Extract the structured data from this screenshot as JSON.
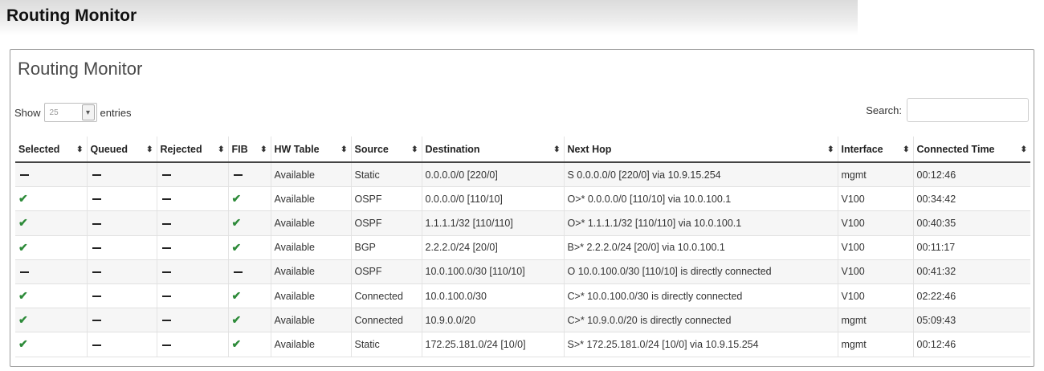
{
  "page": {
    "title": "Routing Monitor"
  },
  "panel": {
    "title": "Routing Monitor",
    "show_label": "Show",
    "entries_value": "25",
    "entries_label": "entries",
    "search_label": "Search:",
    "search_value": ""
  },
  "colors": {
    "check": "#2e8b3a",
    "header_rule": "#444444",
    "row_stripe": "#f6f6f6"
  },
  "table": {
    "columns": [
      "Selected",
      "Queued",
      "Rejected",
      "FIB",
      "HW Table",
      "Source",
      "Destination",
      "Next Hop",
      "Interface",
      "Connected Time"
    ],
    "rows": [
      {
        "selected": "dash",
        "queued": "dash",
        "rejected": "dash",
        "fib": "dash",
        "hw_table": "Available",
        "source": "Static",
        "destination": "0.0.0.0/0 [220/0]",
        "next_hop": "S 0.0.0.0/0 [220/0] via 10.9.15.254",
        "interface": "mgmt",
        "connected_time": "00:12:46"
      },
      {
        "selected": "check",
        "queued": "dash",
        "rejected": "dash",
        "fib": "check",
        "hw_table": "Available",
        "source": "OSPF",
        "destination": "0.0.0.0/0 [110/10]",
        "next_hop": "O>* 0.0.0.0/0 [110/10] via 10.0.100.1",
        "interface": "V100",
        "connected_time": "00:34:42"
      },
      {
        "selected": "check",
        "queued": "dash",
        "rejected": "dash",
        "fib": "check",
        "hw_table": "Available",
        "source": "OSPF",
        "destination": "1.1.1.1/32 [110/110]",
        "next_hop": "O>* 1.1.1.1/32 [110/110] via 10.0.100.1",
        "interface": "V100",
        "connected_time": "00:40:35"
      },
      {
        "selected": "check",
        "queued": "dash",
        "rejected": "dash",
        "fib": "check",
        "hw_table": "Available",
        "source": "BGP",
        "destination": "2.2.2.0/24 [20/0]",
        "next_hop": "B>* 2.2.2.0/24 [20/0] via 10.0.100.1",
        "interface": "V100",
        "connected_time": "00:11:17"
      },
      {
        "selected": "dash",
        "queued": "dash",
        "rejected": "dash",
        "fib": "dash",
        "hw_table": "Available",
        "source": "OSPF",
        "destination": "10.0.100.0/30 [110/10]",
        "next_hop": "O 10.0.100.0/30 [110/10] is directly connected",
        "interface": "V100",
        "connected_time": "00:41:32"
      },
      {
        "selected": "check",
        "queued": "dash",
        "rejected": "dash",
        "fib": "check",
        "hw_table": "Available",
        "source": "Connected",
        "destination": "10.0.100.0/30",
        "next_hop": "C>* 10.0.100.0/30 is directly connected",
        "interface": "V100",
        "connected_time": "02:22:46"
      },
      {
        "selected": "check",
        "queued": "dash",
        "rejected": "dash",
        "fib": "check",
        "hw_table": "Available",
        "source": "Connected",
        "destination": "10.9.0.0/20",
        "next_hop": "C>* 10.9.0.0/20 is directly connected",
        "interface": "mgmt",
        "connected_time": "05:09:43"
      },
      {
        "selected": "check",
        "queued": "dash",
        "rejected": "dash",
        "fib": "check",
        "hw_table": "Available",
        "source": "Static",
        "destination": "172.25.181.0/24 [10/0]",
        "next_hop": "S>* 172.25.181.0/24 [10/0] via 10.9.15.254",
        "interface": "mgmt",
        "connected_time": "00:12:46"
      }
    ]
  }
}
